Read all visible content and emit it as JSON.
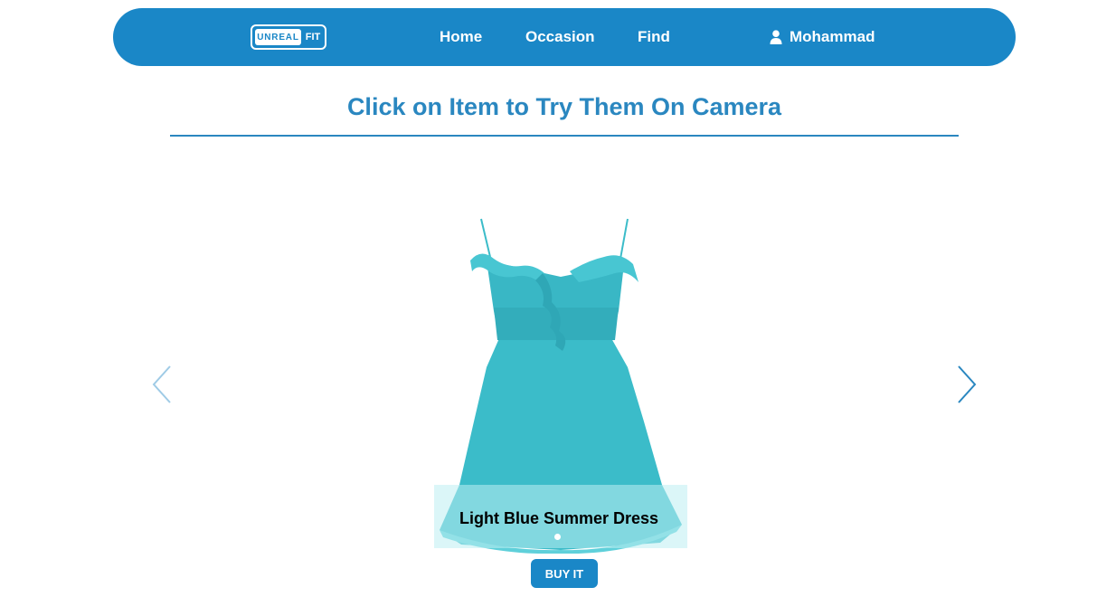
{
  "brand": {
    "logo_left": "UNREAL",
    "logo_right": "FIT"
  },
  "nav": {
    "home": "Home",
    "occasion": "Occasion",
    "find": "Find",
    "user_icon": "user-icon",
    "user_name": "Mohammad"
  },
  "main": {
    "title": "Click on Item to Try Them On Camera"
  },
  "carousel": {
    "item_caption": "Light Blue Summer Dress",
    "prev_icon": "chevron-left-icon",
    "next_icon": "chevron-right-icon",
    "slide_count": 1,
    "active_slide": 1
  },
  "actions": {
    "buy_label": "BUY IT"
  },
  "colors": {
    "primary": "#1a87c7",
    "title": "#2a87c0",
    "dress": "#3bbcc9"
  }
}
